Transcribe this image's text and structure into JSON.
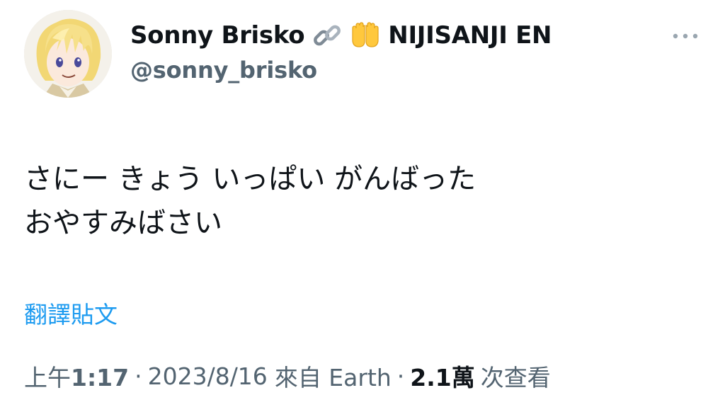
{
  "author": {
    "display_name": "Sonny Brisko",
    "emoji": [
      "link-emoji",
      "palms-up-emoji"
    ],
    "org_name": "NIJISANJI EN",
    "handle": "@sonny_brisko"
  },
  "tweet": {
    "lines": [
      "さにー きょう いっぱい がんばった",
      "おやすみばさい"
    ],
    "translate_label": "翻譯貼文"
  },
  "meta": {
    "time_prefix": "上午",
    "time": "1:17",
    "separator": "·",
    "date": "2023/8/16",
    "source": "來自 Earth",
    "views_count": "2.1萬",
    "views_label": "次查看"
  },
  "colors": {
    "text_primary": "#0f1419",
    "text_secondary": "#536471",
    "link": "#1d9bf0"
  }
}
